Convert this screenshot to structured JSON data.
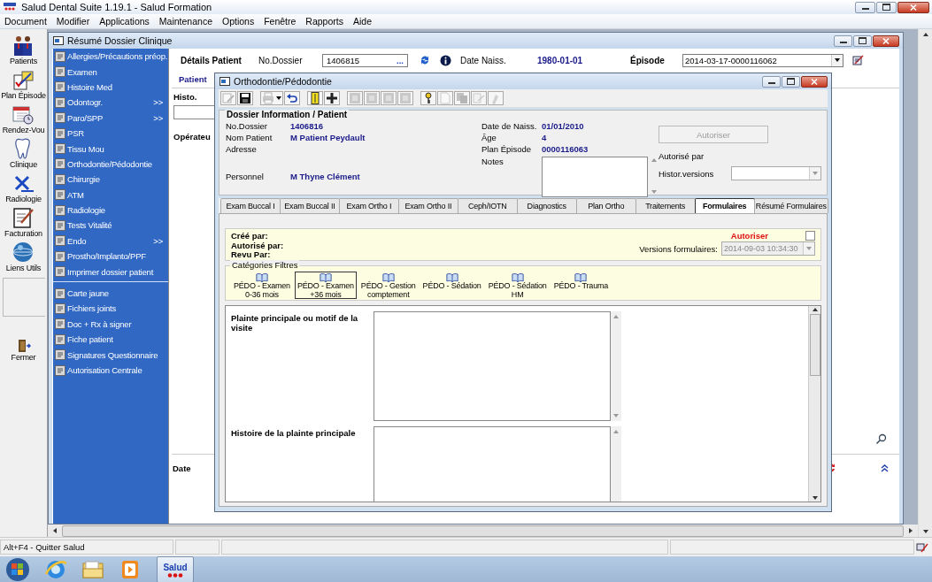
{
  "app": {
    "title": "Salud Dental Suite 1.19.1 - Salud Formation",
    "menu": [
      "Document",
      "Modifier",
      "Applications",
      "Maintenance",
      "Options",
      "Fenêtre",
      "Rapports",
      "Aide"
    ]
  },
  "launcher": [
    {
      "kind": "patients",
      "label": "Patients"
    },
    {
      "kind": "plan",
      "label": "Plan Épisode"
    },
    {
      "kind": "calendar",
      "label": "Rendez-Vou"
    },
    {
      "kind": "tooth",
      "label": "Clinique"
    },
    {
      "kind": "xray",
      "label": "Radiologie"
    },
    {
      "kind": "billing",
      "label": "Facturation"
    },
    {
      "kind": "globe",
      "label": "Liens Utils"
    },
    {
      "kind": "exit",
      "label": "Fermer"
    }
  ],
  "clinical_window": {
    "title": "Résumé Dossier Clinique",
    "sidebar_groups": [
      [
        {
          "label": "Allergies/Précautions préop."
        },
        {
          "label": "Examen"
        },
        {
          "label": "Histoire Med"
        },
        {
          "label": "Odontogr.",
          "arrow": ">>"
        },
        {
          "label": "Paro/SPP",
          "arrow": ">>"
        },
        {
          "label": "PSR"
        },
        {
          "label": "Tissu Mou"
        },
        {
          "label": "Orthodontie/Pédodontie"
        },
        {
          "label": "Chirurgie"
        },
        {
          "label": "ATM"
        },
        {
          "label": "Radiologie"
        },
        {
          "label": "Tests Vitalité"
        },
        {
          "label": "Endo",
          "arrow": ">>"
        },
        {
          "label": "Prostho/Implanto/PPF"
        },
        {
          "label": "Imprimer dossier patient"
        }
      ],
      [
        {
          "label": "Carte jaune"
        },
        {
          "label": "Fichiers joints"
        },
        {
          "label": "Doc + Rx à signer"
        },
        {
          "label": "Fiche patient"
        },
        {
          "label": "Signatures Questionnaire"
        },
        {
          "label": "Autorisation Centrale"
        }
      ]
    ],
    "patient_bar": {
      "heading": "Détails Patient",
      "dossier_label": "No.Dossier",
      "dossier_value": "1406815",
      "browse": "...",
      "birth_label": "Date Naiss.",
      "birth_value": "1980-01-01",
      "episode_label": "Épisode",
      "episode_value": "2014-03-17-0000116062"
    },
    "patient_tab": "Patient",
    "histo_label": "Histo.",
    "operator_label": "Opérateu",
    "date_label": "Date"
  },
  "dialog": {
    "title": "Orthodontie/Pédodontie",
    "toolbar": [
      {
        "kind": "edit",
        "disabled": true
      },
      {
        "kind": "save",
        "disabled": false
      },
      {
        "kind": "print",
        "disabled": true
      },
      {
        "kind": "undo",
        "disabled": false
      },
      {
        "kind": "card",
        "disabled": false
      },
      {
        "kind": "add",
        "disabled": false
      },
      {
        "kind": "grid",
        "disabled": true
      },
      {
        "kind": "grid",
        "disabled": true
      },
      {
        "kind": "grid",
        "disabled": true
      },
      {
        "kind": "grid",
        "disabled": true
      },
      {
        "kind": "key",
        "disabled": false
      },
      {
        "kind": "page",
        "disabled": true
      },
      {
        "kind": "copy",
        "disabled": true
      },
      {
        "kind": "sign",
        "disabled": true
      },
      {
        "kind": "pen",
        "disabled": true
      }
    ],
    "info": {
      "heading": "Dossier Information / Patient",
      "left": [
        {
          "label": "No.Dossier",
          "value": "1406816"
        },
        {
          "label": "Nom Patient",
          "value": "M Patient Peydault"
        },
        {
          "label": "Adresse"
        }
      ],
      "personnel": {
        "label": "Personnel",
        "value": "M Thyne Clément"
      },
      "middle": [
        {
          "label": "Date de Naiss.",
          "value": "01/01/2010"
        },
        {
          "label": "Âge",
          "value": "4"
        },
        {
          "label": "Plan Épisode",
          "value": "0000116063"
        }
      ],
      "notes_label": "Notes",
      "authorize_button": {
        "label": "Autoriser",
        "disabled": true
      },
      "authorized_by": "Autorisé par",
      "versions_label": "Histor.versions"
    },
    "tabs": [
      {
        "label": "Exam Buccal I",
        "selected": false
      },
      {
        "label": "Exam Buccal II",
        "selected": false
      },
      {
        "label": "Exam Ortho I",
        "selected": false
      },
      {
        "label": "Exam Ortho II",
        "selected": false
      },
      {
        "label": "Ceph/IOTN",
        "selected": false
      },
      {
        "label": "Diagnostics",
        "selected": false
      },
      {
        "label": "Plan Ortho",
        "selected": false
      },
      {
        "label": "Traitements",
        "selected": false
      },
      {
        "label": "Formulaires",
        "selected": true
      },
      {
        "label": "Résumé Formulaires",
        "selected": false
      }
    ],
    "form_header": {
      "labels": [
        "Créé par:",
        "Autorisé par:",
        "Revu Par:"
      ],
      "authorize": "Autoriser",
      "authorize_checked": false,
      "versions_label": "Versions formulaires:",
      "versions_value": "2014-09-03 10:34:30"
    },
    "filters": {
      "heading": "Catégories Filtres",
      "items": [
        {
          "lines": [
            "PÉDO - Examen",
            "0-36 mois"
          ],
          "selected": false
        },
        {
          "lines": [
            "PÉDO - Examen",
            "+36 mois"
          ],
          "selected": true
        },
        {
          "lines": [
            "PÉDO - Gestion",
            "comptement"
          ],
          "selected": false
        },
        {
          "lines": [
            "PÉDO - Sédation"
          ],
          "selected": false
        },
        {
          "lines": [
            "PÉDO - Sédation",
            "HM"
          ],
          "selected": false
        },
        {
          "lines": [
            "PÉDO - Trauma"
          ],
          "selected": false
        }
      ]
    },
    "questions": [
      {
        "label": "Plainte principale ou motif de la visite"
      },
      {
        "label": "Histoire de la plainte principale"
      }
    ]
  },
  "status_bar": {
    "hint": "Alt+F4 - Quitter Salud"
  },
  "taskbar": {
    "app_button": "Salud"
  }
}
